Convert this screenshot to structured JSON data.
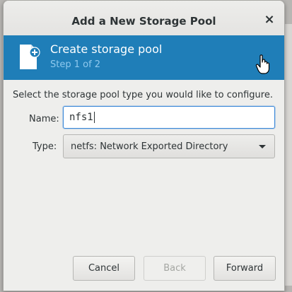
{
  "dialog": {
    "title": "Add a New Storage Pool",
    "close_glyph": "×"
  },
  "header": {
    "title": "Create storage pool",
    "step": "Step 1 of 2",
    "icon": "document-add-icon",
    "colors": {
      "background": "#1f7eb8",
      "step_text": "#8fc9ee"
    }
  },
  "form": {
    "instructions": "Select the storage pool type you would like to configure.",
    "name_label": "Name:",
    "name_value": "nfs1",
    "type_label": "Type:",
    "type_value": "netfs: Network Exported Directory"
  },
  "buttons": {
    "cancel": "Cancel",
    "back": "Back",
    "forward": "Forward"
  }
}
